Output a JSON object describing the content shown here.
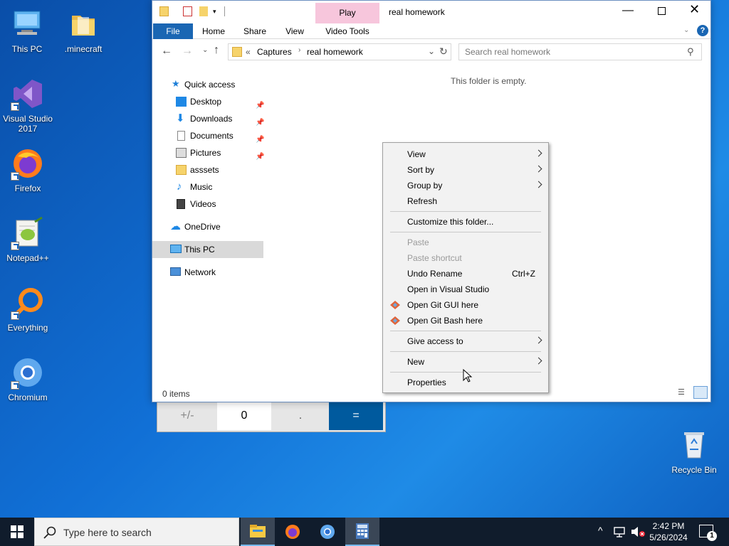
{
  "desktop": {
    "icons": [
      {
        "label": "This PC"
      },
      {
        "label": ".minecraft"
      },
      {
        "label": "Visual Studio 2017"
      },
      {
        "label": "Firefox"
      },
      {
        "label": "Notepad++"
      },
      {
        "label": "Everything"
      },
      {
        "label": "Chromium"
      },
      {
        "label": "Recycle Bin"
      }
    ]
  },
  "calculator": {
    "keys": [
      "+/-",
      "0",
      ".",
      "="
    ]
  },
  "explorer": {
    "title": "real homework",
    "contextual_tab": "Play",
    "tabs": [
      "File",
      "Home",
      "Share",
      "View",
      "Video Tools"
    ],
    "address": {
      "overflow": "«",
      "parts": [
        "Captures",
        "real homework"
      ]
    },
    "search_placeholder": "Search real homework",
    "empty_text": "This folder is empty.",
    "status": "0 items",
    "nav": {
      "quick_access": "Quick access",
      "items": [
        "Desktop",
        "Downloads",
        "Documents",
        "Pictures",
        "asssets",
        "Music",
        "Videos"
      ],
      "onedrive": "OneDrive",
      "this_pc": "This PC",
      "network": "Network"
    }
  },
  "context_menu": {
    "items": [
      {
        "label": "View"
      },
      {
        "label": "Sort by"
      },
      {
        "label": "Group by"
      },
      {
        "label": "Refresh"
      },
      {
        "label": "Customize this folder..."
      },
      {
        "label": "Paste"
      },
      {
        "label": "Paste shortcut"
      },
      {
        "label": "Undo Rename",
        "shortcut": "Ctrl+Z"
      },
      {
        "label": "Open in Visual Studio"
      },
      {
        "label": "Open Git GUI here"
      },
      {
        "label": "Open Git Bash here"
      },
      {
        "label": "Give access to"
      },
      {
        "label": "New"
      },
      {
        "label": "Properties"
      }
    ]
  },
  "taskbar": {
    "search_placeholder": "Type here to search",
    "time": "2:42 PM",
    "date": "5/26/2024",
    "notification_count": "1"
  }
}
